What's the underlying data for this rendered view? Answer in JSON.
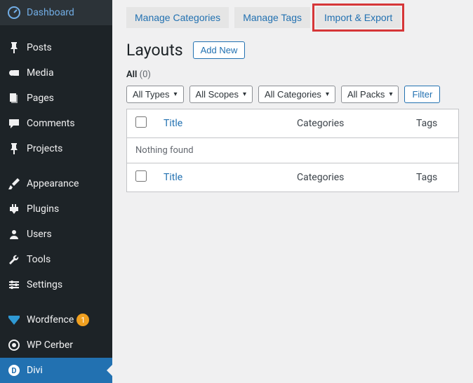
{
  "sidebar": {
    "items": [
      {
        "label": "Dashboard",
        "icon": "dashboard"
      },
      {
        "separator": true
      },
      {
        "label": "Posts",
        "icon": "pin"
      },
      {
        "label": "Media",
        "icon": "media"
      },
      {
        "label": "Pages",
        "icon": "page"
      },
      {
        "label": "Comments",
        "icon": "comment"
      },
      {
        "label": "Projects",
        "icon": "pin"
      },
      {
        "separator": true
      },
      {
        "label": "Appearance",
        "icon": "brush"
      },
      {
        "label": "Plugins",
        "icon": "plugin"
      },
      {
        "label": "Users",
        "icon": "user"
      },
      {
        "label": "Tools",
        "icon": "wrench"
      },
      {
        "label": "Settings",
        "icon": "settings"
      },
      {
        "separator": true
      },
      {
        "label": "Wordfence",
        "icon": "wordfence",
        "badge": "1",
        "badge_color": "orange"
      },
      {
        "label": "WP Cerber",
        "icon": "cerber"
      },
      {
        "label": "Divi",
        "icon": "divi",
        "active": true
      }
    ]
  },
  "tabs": {
    "manage_categories": "Manage Categories",
    "manage_tags": "Manage Tags",
    "import_export": "Import & Export"
  },
  "header": {
    "title": "Layouts",
    "add_new": "Add New"
  },
  "subsubsub": {
    "all": "All",
    "count": "(0)"
  },
  "filters": {
    "types": "All Types",
    "scopes": "All Scopes",
    "categories": "All Categories",
    "packs": "All Packs",
    "filter_btn": "Filter"
  },
  "table": {
    "title": "Title",
    "categories": "Categories",
    "tags": "Tags",
    "nothing": "Nothing found"
  }
}
